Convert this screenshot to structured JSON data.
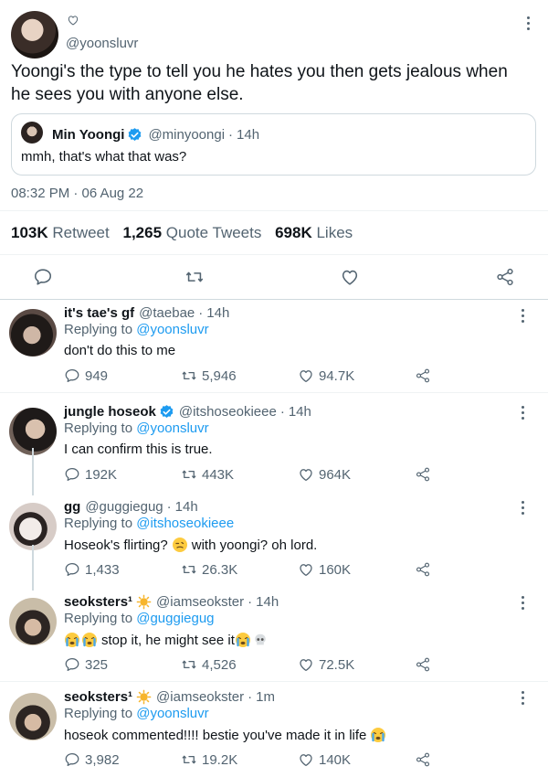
{
  "main": {
    "handle": "@yoonsluvr",
    "text": "Yoongi's the type to tell you he hates you then gets jealous when he sees you with anyone else.",
    "quote": {
      "name": "Min Yoongi",
      "handle": "@minyoongi",
      "time": "14h",
      "text": "mmh, that's what that was?"
    },
    "timestamp": "08:32 PM · 06 Aug 22",
    "stats": {
      "retweets": "103K",
      "retweets_label": "Retweet",
      "quotes": "1,265",
      "quotes_label": "Quote Tweets",
      "likes": "698K",
      "likes_label": "Likes"
    }
  },
  "replies": [
    {
      "name": "it's tae's gf",
      "handle": "@taebae",
      "time": "14h",
      "replying_prefix": "Replying to",
      "replying_to": "@yoonsluvr",
      "text": "don't do this to me",
      "replies": "949",
      "retweets": "5,946",
      "likes": "94.7K"
    },
    {
      "name": "jungle hoseok",
      "handle": "@itshoseokieee",
      "time": "14h",
      "replying_prefix": "Replying to",
      "replying_to": "@yoonsluvr",
      "text": "I can confirm this is true.",
      "replies": "192K",
      "retweets": "443K",
      "likes": "964K"
    },
    {
      "name": "gg",
      "handle": "@guggiegug",
      "time": "14h",
      "replying_prefix": "Replying to",
      "replying_to": "@itshoseokieee",
      "text_a": "Hoseok's flirting?",
      "text_b": "with yoongi? oh lord.",
      "replies": "1,433",
      "retweets": "26.3K",
      "likes": "160K"
    },
    {
      "name": "seoksters¹",
      "handle": "@iamseokster",
      "time": "14h",
      "replying_prefix": "Replying to",
      "replying_to": "@guggiegug",
      "text": "stop it, he might see it",
      "replies": "325",
      "retweets": "4,526",
      "likes": "72.5K"
    },
    {
      "name": "seoksters¹",
      "handle": "@iamseokster",
      "time": "1m",
      "replying_prefix": "Replying to",
      "replying_to": "@yoonsluvr",
      "text": "hoseok commented!!!! bestie you've made it in life",
      "replies": "3,982",
      "retweets": "19.2K",
      "likes": "140K"
    }
  ],
  "icons": {
    "reply": "reply-icon",
    "retweet": "retweet-icon",
    "like": "heart-icon",
    "share": "share-icon",
    "more": "more-icon",
    "verified": "verified-badge-icon",
    "sun": "sun-emoji-icon",
    "crying": "crying-emoji-icon",
    "skull": "skull-emoji-icon",
    "wink": "wink-emoji-icon"
  },
  "colors": {
    "accent": "#1d9bf0",
    "muted": "#536471",
    "text": "#0f1419",
    "border": "#eff3f4"
  }
}
